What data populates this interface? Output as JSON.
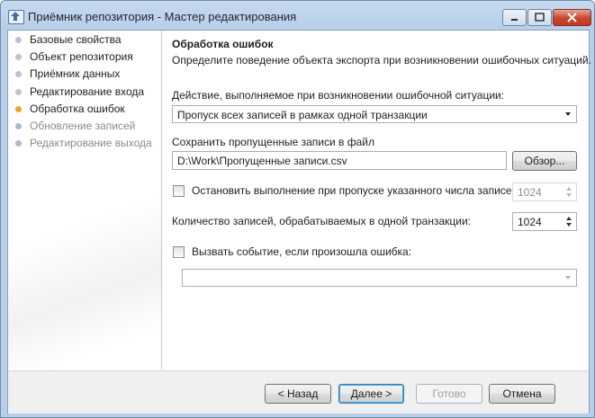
{
  "window": {
    "title": "Приёмник репозитория - Мастер редактирования",
    "app_icon": "upload-arrow-icon",
    "controls": [
      "minimize-icon",
      "maximize-icon",
      "close-icon"
    ]
  },
  "sidebar": {
    "steps": [
      {
        "label": "Базовые свойства",
        "state": "done"
      },
      {
        "label": "Объект репозитория",
        "state": "done"
      },
      {
        "label": "Приёмник данных",
        "state": "done"
      },
      {
        "label": "Редактирование входа",
        "state": "done"
      },
      {
        "label": "Обработка ошибок",
        "state": "current"
      },
      {
        "label": "Обновление записей",
        "state": "pending"
      },
      {
        "label": "Редактирование выхода",
        "state": "pending"
      }
    ]
  },
  "page": {
    "heading": "Обработка ошибок",
    "description": "Определите поведение объекта экспорта при возникновении ошибочных ситуаций.",
    "action_label": "Действие, выполняемое при возникновении ошибочной ситуации:",
    "action_value": "Пропуск всех записей в рамках одной транзакции",
    "save_label": "Сохранить пропущенные записи в файл",
    "save_path": "D:\\Work\\Пропущенные записи.csv",
    "browse_label": "Обзор...",
    "stop_label": "Остановить выполнение при пропуске указанного числа записей:",
    "stop_checked": false,
    "stop_value": "1024",
    "batch_label": "Количество записей, обрабатываемых в одной транзакции:",
    "batch_value": "1024",
    "event_label": "Вызвать событие, если произошла ошибка:",
    "event_checked": false,
    "event_value": ""
  },
  "footer": {
    "back_label": "< Назад",
    "next_label": "Далее >",
    "finish_label": "Готово",
    "cancel_label": "Отмена"
  },
  "colors": {
    "current_step_dot": "#f0a030",
    "done_step_dot": "#b9c4d3",
    "pending_step_dot": "#a9b9cc",
    "title_bar": "#b9cfe9"
  }
}
